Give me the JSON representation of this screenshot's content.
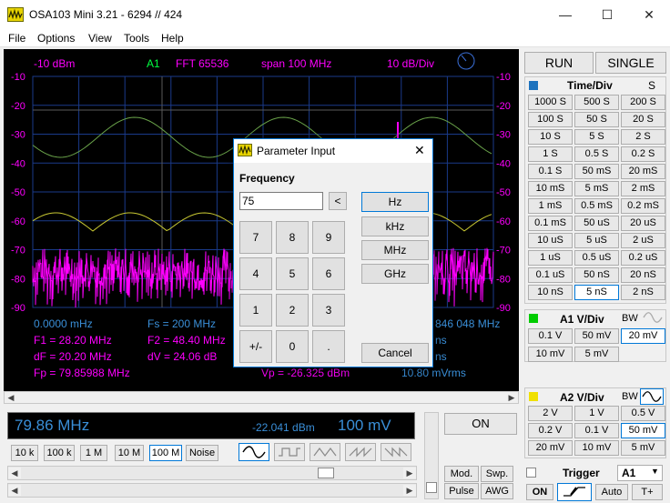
{
  "window": {
    "title": "OSA103 Mini 3.21  -  6294  //   424",
    "min_icon": "minimize-icon",
    "max_icon": "maximize-icon",
    "close_icon": "close-icon"
  },
  "menu": [
    "File",
    "Options",
    "View",
    "Tools",
    "Help"
  ],
  "scope": {
    "ref_level": "-10 dBm",
    "channel": "A1",
    "fft": "FFT  65536",
    "span": "span 100 MHz",
    "scale": "10 dB/Div",
    "y_ticks": [
      "-10",
      "-20",
      "-30",
      "-40",
      "-50",
      "-60",
      "-70",
      "-80",
      "-90"
    ],
    "colors": {
      "bg": "#000000",
      "grid": "#1a3a8a",
      "label_magenta": "#ff00ff",
      "label_green": "#00ff40",
      "label_blue": "#3a8fd8",
      "trace_magenta": "#ff00ff",
      "trace_yellow": "#c8c832",
      "trace_green": "#6aa34a"
    },
    "readouts": {
      "r1c1": "0.0000 mHz",
      "r1c2": "Fs = 200 MHz",
      "r1c3": "846 048 MHz",
      "r2c1": "F1 = 28.20 MHz",
      "r2c2": "F2 = 48.40 MHz",
      "r2c3": "ns",
      "r3c1": "dF = 20.20 MHz",
      "r3c2": "dV = 24.06 dB",
      "r3c3": "ns",
      "r4c1": "Fp = 79.85988 MHz",
      "r4c2": "Vp = -26.325 dBm",
      "r4c3": "10.80 mVrms"
    }
  },
  "bottom": {
    "freq": "79.86 MHz",
    "level": "-22.041 dBm",
    "volt": "100 mV",
    "on_label": "ON",
    "span_buttons": [
      "10 k",
      "100 k",
      "1 M",
      "10 M",
      "100 M",
      "Noise"
    ],
    "selected_span": "100 M",
    "wave_icons": [
      "sine-wave-icon",
      "square-wave-icon",
      "triangle-wave-icon",
      "sawtooth-wave-icon",
      "reverse-sawtooth-wave-icon"
    ],
    "mod_label": "Mod.",
    "swp_label": "Swp.",
    "pulse_label": "Pulse",
    "awg_label": "AWG"
  },
  "right": {
    "run_label": "RUN",
    "single_label": "SINGLE",
    "timediv_title": "Time/Div",
    "timediv_unit": "S",
    "timediv_buttons": [
      [
        "1000 S",
        "500 S",
        "200 S"
      ],
      [
        "100 S",
        "50 S",
        "20 S"
      ],
      [
        "10 S",
        "5 S",
        "2 S"
      ],
      [
        "1 S",
        "0.5 S",
        "0.2 S"
      ],
      [
        "0.1 S",
        "50 mS",
        "20 mS"
      ],
      [
        "10 mS",
        "5 mS",
        "2 mS"
      ],
      [
        "1 mS",
        "0.5 mS",
        "0.2 mS"
      ],
      [
        "0.1 mS",
        "50 uS",
        "20 uS"
      ],
      [
        "10 uS",
        "5 uS",
        "2 uS"
      ],
      [
        "1 uS",
        "0.5 uS",
        "0.2 uS"
      ],
      [
        "0.1 uS",
        "50 nS",
        "20 nS"
      ],
      [
        "10 nS",
        "5 nS",
        "2 nS"
      ]
    ],
    "a1_title": "A1 V/Div",
    "a1_bw": "BW",
    "a1_buttons": [
      [
        "0.1 V",
        "50 mV",
        "20 mV"
      ],
      [
        "10 mV",
        "5 mV"
      ]
    ],
    "a2_title": "A2 V/Div",
    "a2_bw": "BW",
    "a2_buttons": [
      [
        "2 V",
        "1 V",
        "0.5 V"
      ],
      [
        "0.2 V",
        "0.1 V",
        "50 mV"
      ],
      [
        "20 mV",
        "10 mV",
        "5 mV"
      ]
    ],
    "trigger_title": "Trigger",
    "trigger_source": "A1",
    "trig_on": "ON",
    "trig_auto": "Auto",
    "trig_tplus": "T+",
    "colors": {
      "timediv": "#1e73be",
      "a1": "#00cc00",
      "a2": "#f0e000"
    }
  },
  "dialog": {
    "title": "Parameter Input",
    "label": "Frequency",
    "value": "75",
    "back": "<",
    "keys": [
      "7",
      "8",
      "9",
      "4",
      "5",
      "6",
      "1",
      "2",
      "3",
      "+/-",
      "0",
      "."
    ],
    "units": [
      "Hz",
      "kHz",
      "MHz",
      "GHz"
    ],
    "cancel": "Cancel"
  }
}
